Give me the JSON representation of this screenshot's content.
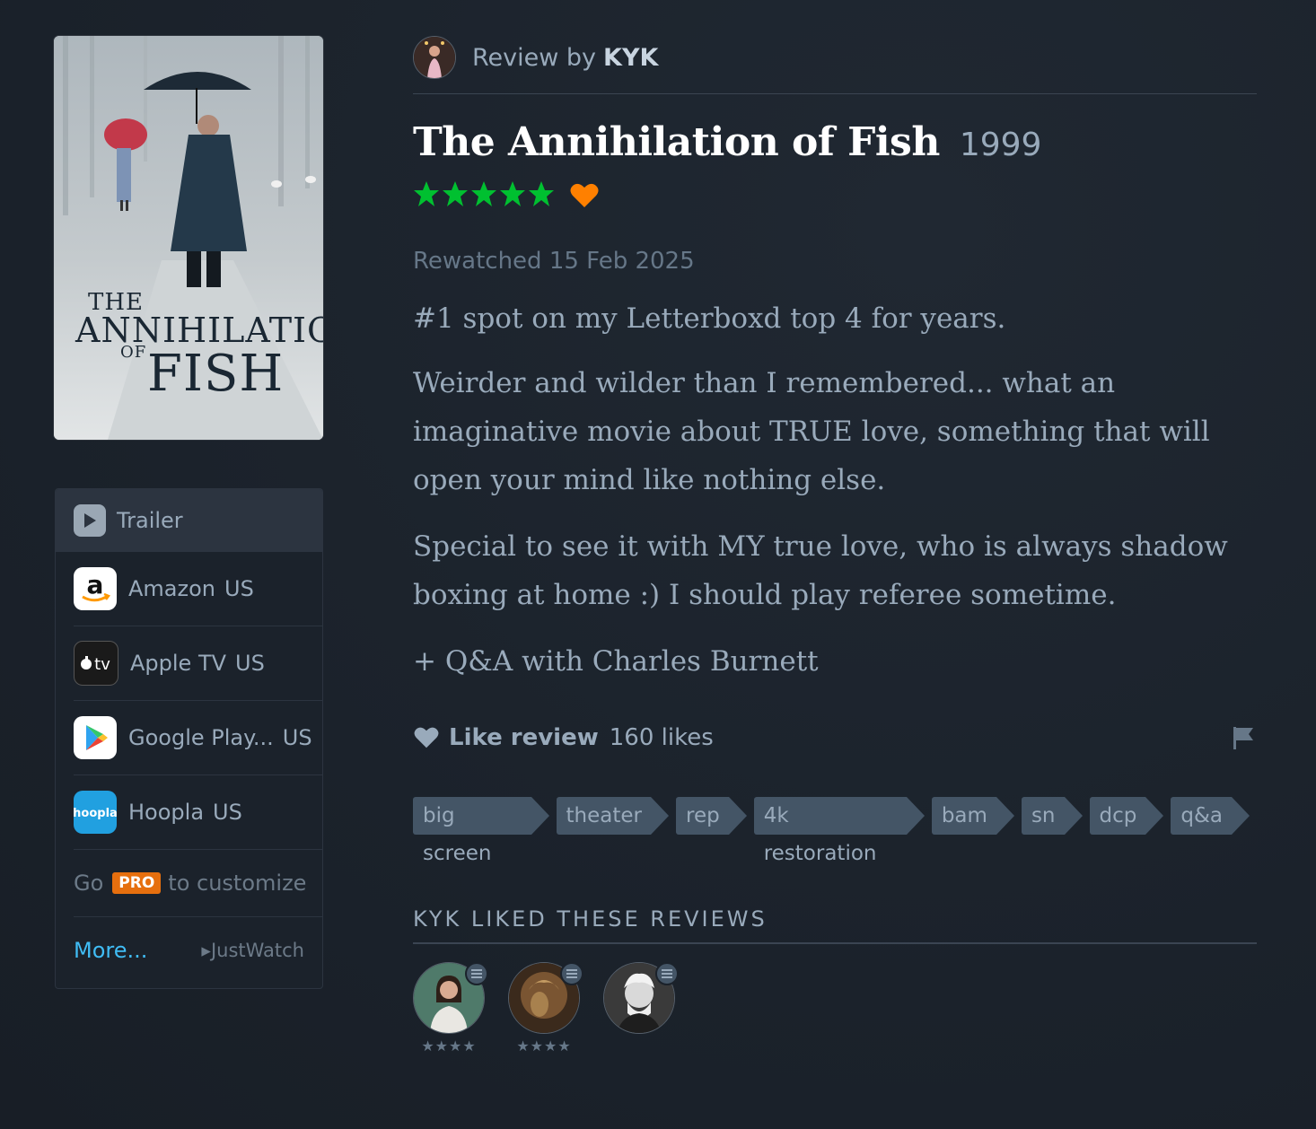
{
  "poster": {
    "title_lines": [
      "THE",
      "ANNIHILATION",
      "OF",
      "FISH"
    ]
  },
  "watch": {
    "trailer_label": "Trailer",
    "services": [
      {
        "name": "Amazon",
        "country": "US",
        "icon": "amazon-icon"
      },
      {
        "name": "Apple TV",
        "country": "US",
        "icon": "apple-tv-icon"
      },
      {
        "name": "Google Play...",
        "country": "US",
        "icon": "google-play-icon"
      },
      {
        "name": "Hoopla",
        "country": "US",
        "icon": "hoopla-icon"
      }
    ],
    "gopro_prefix": "Go",
    "pro_badge": "PRO",
    "gopro_suffix": "to customize",
    "more_link": "More...",
    "justwatch": "JustWatch"
  },
  "review": {
    "byline_label": "Review by",
    "username": "KYK",
    "film_title": "The Annihilation of Fish",
    "year": "1999",
    "rating_stars": 5,
    "liked": true,
    "watched_text": "Rewatched 15 Feb 2025",
    "paragraphs": [
      "#1 spot on my Letterboxd top 4 for years.",
      "Weirder and wilder than I remembered... what an imaginative movie about TRUE love, something that will open your mind like nothing else.",
      "Special to see it with MY true love, who is always shadow boxing at home :) I should play referee sometime.",
      "+ Q&A with Charles Burnett"
    ],
    "like_label": "Like review",
    "likes_count": "160 likes",
    "tags": [
      "big screen",
      "theater",
      "rep",
      "4k restoration",
      "bam",
      "sn",
      "dcp",
      "q&a"
    ]
  },
  "liked_reviews": {
    "heading": "KYK LIKED THESE REVIEWS",
    "items": [
      {
        "stars": "★★★★"
      },
      {
        "stars": "★★★★"
      },
      {
        "stars": ""
      }
    ]
  },
  "colors": {
    "background": "#1b222b",
    "star_green": "#00c030",
    "heart_orange": "#ff8000",
    "link_blue": "#40bcf4",
    "pro_orange": "#e66f0e",
    "tag_bg": "#445566"
  }
}
